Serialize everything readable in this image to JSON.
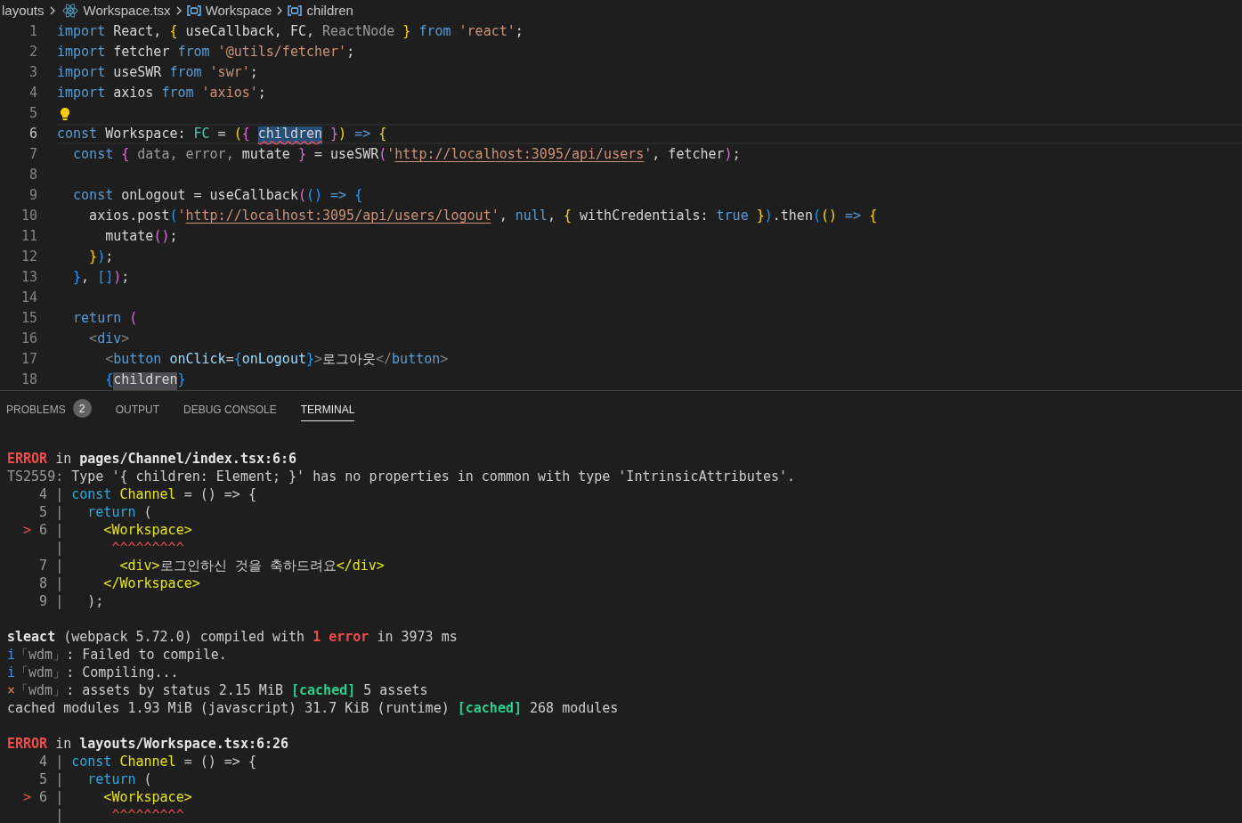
{
  "breadcrumb": [
    {
      "label": "layouts",
      "kind": "folder"
    },
    {
      "label": "Workspace.tsx",
      "kind": "file"
    },
    {
      "label": "Workspace",
      "kind": "symbol"
    },
    {
      "label": "children",
      "kind": "symbol"
    }
  ],
  "editor": {
    "lines": [
      {
        "n": "1",
        "current": false,
        "lightbulb": false,
        "tokens": [
          {
            "kind": "kw",
            "t": "import"
          },
          {
            "kind": "pl",
            "t": " React, "
          },
          {
            "kind": "b1",
            "t": "{"
          },
          {
            "kind": "pl",
            "t": " useCallback, FC, "
          },
          {
            "kind": "dim",
            "t": "ReactNode"
          },
          {
            "kind": "b1",
            "t": " }"
          },
          {
            "kind": "kw",
            "t": " from"
          },
          {
            "kind": "str",
            "t": " 'react'"
          },
          {
            "kind": "pl",
            "t": ";"
          }
        ]
      },
      {
        "n": "2",
        "current": false,
        "lightbulb": false,
        "tokens": [
          {
            "kind": "kw",
            "t": "import"
          },
          {
            "kind": "pl",
            "t": " fetcher "
          },
          {
            "kind": "kw",
            "t": "from"
          },
          {
            "kind": "str",
            "t": " '@utils/fetcher'"
          },
          {
            "kind": "pl",
            "t": ";"
          }
        ]
      },
      {
        "n": "3",
        "current": false,
        "lightbulb": false,
        "tokens": [
          {
            "kind": "kw",
            "t": "import"
          },
          {
            "kind": "pl",
            "t": " useSWR "
          },
          {
            "kind": "kw",
            "t": "from"
          },
          {
            "kind": "str",
            "t": " 'swr'"
          },
          {
            "kind": "pl",
            "t": ";"
          }
        ]
      },
      {
        "n": "4",
        "current": false,
        "lightbulb": false,
        "tokens": [
          {
            "kind": "kw",
            "t": "import"
          },
          {
            "kind": "pl",
            "t": " axios "
          },
          {
            "kind": "kw",
            "t": "from"
          },
          {
            "kind": "str",
            "t": " 'axios'"
          },
          {
            "kind": "pl",
            "t": ";"
          }
        ]
      },
      {
        "n": "5",
        "current": false,
        "lightbulb": true
      },
      {
        "n": "6",
        "current": true,
        "lightbulb": false,
        "tokens": [
          {
            "kind": "kw",
            "t": "const"
          },
          {
            "kind": "pl",
            "t": " Workspace: "
          },
          {
            "kind": "ty",
            "t": "FC"
          },
          {
            "kind": "pl",
            "t": " = "
          },
          {
            "kind": "b1",
            "t": "("
          },
          {
            "kind": "b2",
            "t": "{ "
          },
          {
            "kind": "sel",
            "t": "children",
            "error": true
          },
          {
            "kind": "b2",
            "t": " }"
          },
          {
            "kind": "b1",
            "t": ")"
          },
          {
            "kind": "kw",
            "t": " =>"
          },
          {
            "kind": "b1",
            "t": " {"
          }
        ]
      },
      {
        "n": "7",
        "current": false,
        "lightbulb": false,
        "tokens": [
          {
            "kind": "kw",
            "t": "  const"
          },
          {
            "kind": "b2",
            "t": " {"
          },
          {
            "kind": "dim",
            "t": " data, error,"
          },
          {
            "kind": "pl",
            "t": " mutate "
          },
          {
            "kind": "b2",
            "t": "}"
          },
          {
            "kind": "pl",
            "t": " = useSWR"
          },
          {
            "kind": "b2",
            "t": "("
          },
          {
            "kind": "str",
            "t": "'"
          },
          {
            "kind": "str",
            "t": "http://localhost:3095/api/users",
            "link": true
          },
          {
            "kind": "str",
            "t": "'"
          },
          {
            "kind": "pl",
            "t": ", fetcher"
          },
          {
            "kind": "b2",
            "t": ")"
          },
          {
            "kind": "pl",
            "t": ";"
          }
        ]
      },
      {
        "n": "8",
        "current": false,
        "lightbulb": false
      },
      {
        "n": "9",
        "current": false,
        "lightbulb": false,
        "tokens": [
          {
            "kind": "kw",
            "t": "  const"
          },
          {
            "kind": "pl",
            "t": " onLogout = useCallback"
          },
          {
            "kind": "b2",
            "t": "("
          },
          {
            "kind": "b3",
            "t": "()"
          },
          {
            "kind": "kw",
            "t": " =>"
          },
          {
            "kind": "b3",
            "t": " {"
          }
        ]
      },
      {
        "n": "10",
        "current": false,
        "lightbulb": false,
        "tokens": [
          {
            "kind": "pl",
            "t": "    axios.post"
          },
          {
            "kind": "b3",
            "t": "("
          },
          {
            "kind": "str",
            "t": "'"
          },
          {
            "kind": "str",
            "t": "http://localhost:3095/api/users/logout",
            "link": true
          },
          {
            "kind": "str",
            "t": "'"
          },
          {
            "kind": "pl",
            "t": ", "
          },
          {
            "kind": "kw",
            "t": "null"
          },
          {
            "kind": "pl",
            "t": ", "
          },
          {
            "kind": "b1",
            "t": "{"
          },
          {
            "kind": "pl",
            "t": " withCredentials: "
          },
          {
            "kind": "kw",
            "t": "true"
          },
          {
            "kind": "b1",
            "t": " }"
          },
          {
            "kind": "b3",
            "t": ")"
          },
          {
            "kind": "pl",
            "t": ".then"
          },
          {
            "kind": "b3",
            "t": "("
          },
          {
            "kind": "b1",
            "t": "()"
          },
          {
            "kind": "kw",
            "t": " =>"
          },
          {
            "kind": "b1",
            "t": " {"
          }
        ]
      },
      {
        "n": "11",
        "current": false,
        "lightbulb": false,
        "tokens": [
          {
            "kind": "pl",
            "t": "      mutate"
          },
          {
            "kind": "b2",
            "t": "()"
          },
          {
            "kind": "pl",
            "t": ";"
          }
        ]
      },
      {
        "n": "12",
        "current": false,
        "lightbulb": false,
        "tokens": [
          {
            "kind": "b1",
            "t": "    }"
          },
          {
            "kind": "b3",
            "t": ")"
          },
          {
            "kind": "pl",
            "t": ";"
          }
        ]
      },
      {
        "n": "13",
        "current": false,
        "lightbulb": false,
        "tokens": [
          {
            "kind": "b3",
            "t": "  }"
          },
          {
            "kind": "pl",
            "t": ", "
          },
          {
            "kind": "b3",
            "t": "[]"
          },
          {
            "kind": "b2",
            "t": ")"
          },
          {
            "kind": "pl",
            "t": ";"
          }
        ]
      },
      {
        "n": "14",
        "current": false,
        "lightbulb": false
      },
      {
        "n": "15",
        "current": false,
        "lightbulb": false,
        "tokens": [
          {
            "kind": "kw",
            "t": "  return"
          },
          {
            "kind": "b2",
            "t": " ("
          }
        ]
      },
      {
        "n": "16",
        "current": false,
        "lightbulb": false,
        "tokens": [
          {
            "kind": "tp",
            "t": "    <"
          },
          {
            "kind": "kw",
            "t": "div"
          },
          {
            "kind": "tp",
            "t": ">"
          }
        ]
      },
      {
        "n": "17",
        "current": false,
        "lightbulb": false,
        "tokens": [
          {
            "kind": "tp",
            "t": "      <"
          },
          {
            "kind": "kw",
            "t": "button"
          },
          {
            "kind": "attr",
            "t": " onClick"
          },
          {
            "kind": "pl",
            "t": "="
          },
          {
            "kind": "b3",
            "t": "{"
          },
          {
            "kind": "attr",
            "t": "onLogout"
          },
          {
            "kind": "b3",
            "t": "}"
          },
          {
            "kind": "tp",
            "t": ">"
          },
          {
            "kind": "pl",
            "t": "로그아웃"
          },
          {
            "kind": "tp",
            "t": "</"
          },
          {
            "kind": "kw",
            "t": "button"
          },
          {
            "kind": "tp",
            "t": ">"
          }
        ]
      },
      {
        "n": "18",
        "current": false,
        "lightbulb": false,
        "tokens": [
          {
            "kind": "b3",
            "t": "      {"
          },
          {
            "kind": "occ",
            "t": "children",
            "error": false
          },
          {
            "kind": "b3",
            "t": "}"
          }
        ]
      }
    ]
  },
  "panel": {
    "tabs": [
      {
        "label": "PROBLEMS",
        "badge": "2",
        "selected": false
      },
      {
        "label": "OUTPUT",
        "selected": false
      },
      {
        "label": "DEBUG CONSOLE",
        "selected": false
      },
      {
        "label": "TERMINAL",
        "selected": true
      }
    ],
    "terminal": [
      {
        "space_before": false,
        "tokens": [
          {
            "kind": "err",
            "t": "ERROR"
          },
          {
            "kind": "pl",
            "t": " in "
          },
          {
            "kind": "bold",
            "t": "pages/Channel/index.tsx:6:6"
          }
        ]
      },
      {
        "space_before": false,
        "tokens": [
          {
            "kind": "gray",
            "t": "TS2559:"
          },
          {
            "kind": "pl",
            "t": " Type '{ children: Element; }' has no properties in common with type 'IntrinsicAttributes'."
          }
        ]
      },
      {
        "space_before": false,
        "tokens": [
          {
            "kind": "gray",
            "t": "    4 | "
          },
          {
            "kind": "blue",
            "t": "const"
          },
          {
            "kind": "yel",
            "t": " Channel"
          },
          {
            "kind": "pl",
            "t": " = () => {"
          }
        ]
      },
      {
        "space_before": false,
        "tokens": [
          {
            "kind": "gray",
            "t": "    5 | "
          },
          {
            "kind": "blue",
            "t": "  return"
          },
          {
            "kind": "pl",
            "t": " ("
          }
        ]
      },
      {
        "space_before": false,
        "tokens": [
          {
            "kind": "red",
            "t": "  >"
          },
          {
            "kind": "gray",
            "t": " 6 | "
          },
          {
            "kind": "yel",
            "t": "    <Workspace>"
          }
        ]
      },
      {
        "space_before": false,
        "tokens": [
          {
            "kind": "gray",
            "t": "      | "
          },
          {
            "kind": "red",
            "t": "     ^^^^^^^^^"
          }
        ]
      },
      {
        "space_before": false,
        "tokens": [
          {
            "kind": "gray",
            "t": "    7 | "
          },
          {
            "kind": "yel",
            "t": "      <div>"
          },
          {
            "kind": "pl",
            "t": "로그인하신 것을 축하드려요"
          },
          {
            "kind": "yel",
            "t": "</div>"
          }
        ]
      },
      {
        "space_before": false,
        "tokens": [
          {
            "kind": "gray",
            "t": "    8 | "
          },
          {
            "kind": "yel",
            "t": "    </Workspace>"
          }
        ]
      },
      {
        "space_before": false,
        "tokens": [
          {
            "kind": "gray",
            "t": "    9 | "
          },
          {
            "kind": "pl",
            "t": "  );"
          }
        ]
      },
      {
        "space_before": true,
        "tokens": [
          {
            "kind": "bold",
            "t": "sleact"
          },
          {
            "kind": "pl",
            "t": " (webpack 5.72.0) compiled with "
          },
          {
            "kind": "err",
            "t": "1 error"
          },
          {
            "kind": "pl",
            "t": " in 3973 ms"
          }
        ]
      },
      {
        "space_before": false,
        "tokens": [
          {
            "kind": "info",
            "t": "i"
          },
          {
            "kind": "gray",
            "t": "「wdm」"
          },
          {
            "kind": "pl",
            "t": ": Failed to compile."
          }
        ]
      },
      {
        "space_before": false,
        "tokens": [
          {
            "kind": "info",
            "t": "i"
          },
          {
            "kind": "gray",
            "t": "「wdm」"
          },
          {
            "kind": "pl",
            "t": ": Compiling..."
          }
        ]
      },
      {
        "space_before": false,
        "tokens": [
          {
            "kind": "warn",
            "t": "×"
          },
          {
            "kind": "gray",
            "t": "「wdm」"
          },
          {
            "kind": "pl",
            "t": ": assets by status 2.15 MiB "
          },
          {
            "kind": "ok",
            "t": "[cached]"
          },
          {
            "kind": "pl",
            "t": " 5 assets"
          }
        ]
      },
      {
        "space_before": false,
        "tokens": [
          {
            "kind": "pl",
            "t": "cached modules 1.93 MiB (javascript) 31.7 KiB (runtime) "
          },
          {
            "kind": "ok",
            "t": "[cached]"
          },
          {
            "kind": "pl",
            "t": " 268 modules"
          }
        ]
      },
      {
        "space_before": true,
        "tokens": [
          {
            "kind": "err",
            "t": "ERROR"
          },
          {
            "kind": "pl",
            "t": " in "
          },
          {
            "kind": "bold",
            "t": "layouts/Workspace.tsx:6:26"
          }
        ]
      },
      {
        "space_before": false,
        "tokens": [
          {
            "kind": "gray",
            "t": "    4 | "
          },
          {
            "kind": "blue",
            "t": "const"
          },
          {
            "kind": "yel",
            "t": " Channel"
          },
          {
            "kind": "pl",
            "t": " = () => {"
          }
        ]
      },
      {
        "space_before": false,
        "tokens": [
          {
            "kind": "gray",
            "t": "    5 | "
          },
          {
            "kind": "blue",
            "t": "  return"
          },
          {
            "kind": "pl",
            "t": " ("
          }
        ]
      },
      {
        "space_before": false,
        "tokens": [
          {
            "kind": "red",
            "t": "  >"
          },
          {
            "kind": "gray",
            "t": " 6 | "
          },
          {
            "kind": "yel",
            "t": "    <Workspace>"
          }
        ]
      },
      {
        "space_before": false,
        "tokens": [
          {
            "kind": "gray",
            "t": "      | "
          },
          {
            "kind": "red",
            "t": "     ^^^^^^^^^"
          }
        ]
      }
    ]
  }
}
